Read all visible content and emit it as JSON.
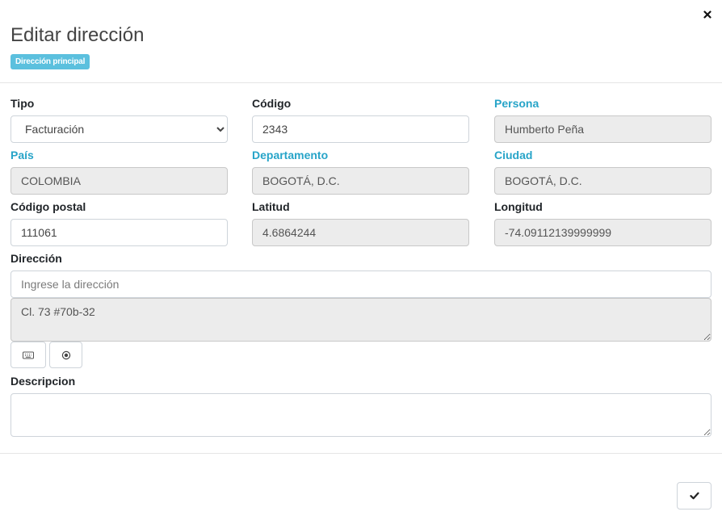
{
  "dialog": {
    "title": "Editar dirección",
    "badge": "Dirección principal"
  },
  "colors": {
    "badge_bg": "#5bc0de",
    "info_label": "#27a4c8",
    "readonly_bg": "#ececec"
  },
  "fields": {
    "tipo": {
      "label": "Tipo",
      "value": "Facturación",
      "options": [
        "Facturación"
      ]
    },
    "codigo": {
      "label": "Código",
      "value": "2343"
    },
    "persona": {
      "label": "Persona",
      "value": "Humberto Peña"
    },
    "pais": {
      "label": "País",
      "value": "COLOMBIA"
    },
    "departamento": {
      "label": "Departamento",
      "value": "BOGOTÁ, D.C."
    },
    "ciudad": {
      "label": "Ciudad",
      "value": "BOGOTÁ, D.C."
    },
    "codigo_postal": {
      "label": "Código postal",
      "value": "111061"
    },
    "latitud": {
      "label": "Latitud",
      "value": "4.6864244"
    },
    "longitud": {
      "label": "Longitud",
      "value": "-74.09112139999999"
    },
    "direccion": {
      "label": "Dirección",
      "placeholder": "Ingrese la dirección",
      "value": "Cl. 73 #70b-32"
    },
    "descripcion": {
      "label": "Descripcion",
      "value": ""
    }
  },
  "icons": {
    "close": "close-icon",
    "keyboard": "keyboard-icon",
    "location": "location-target-icon",
    "confirm": "check-icon"
  }
}
